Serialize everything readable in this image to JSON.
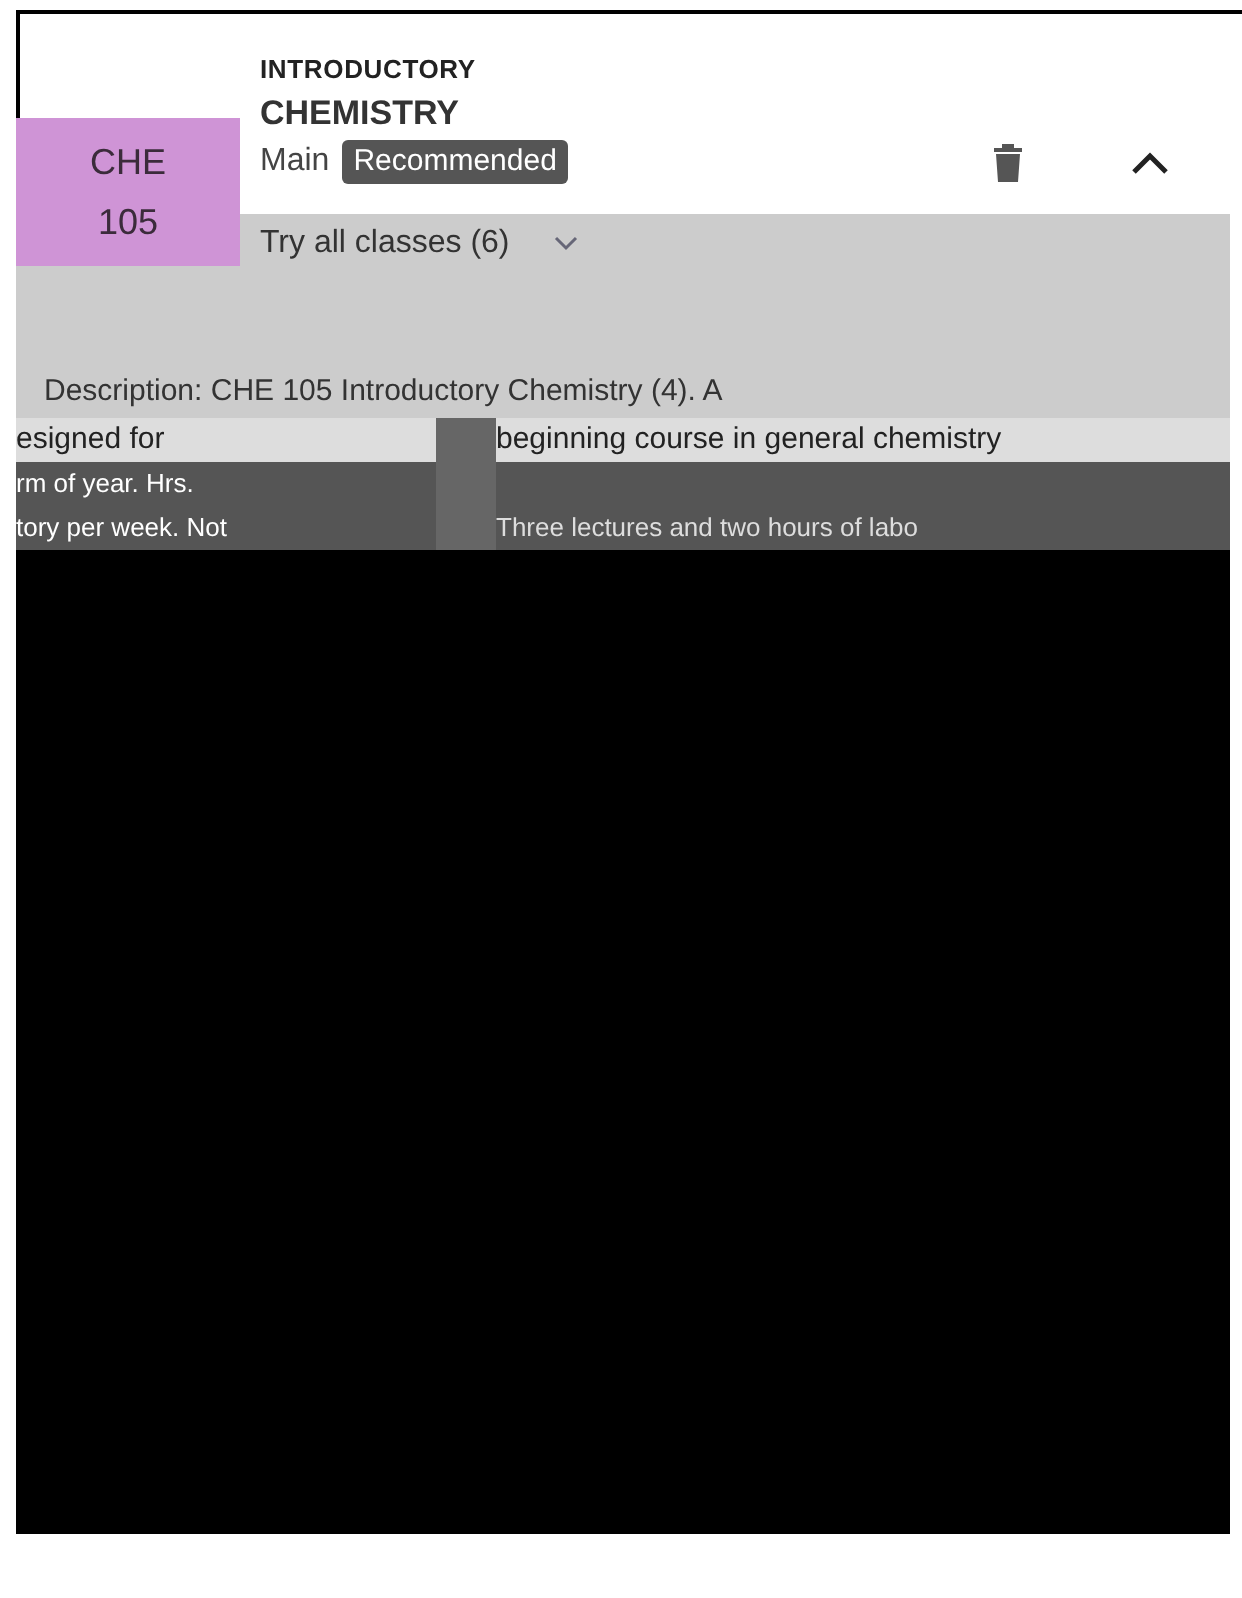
{
  "course": {
    "code": "CHE",
    "number": "105",
    "title_lines": [
      "INTRODUCTORY",
      "CHEMISTRY"
    ],
    "section": "Main",
    "badge": "Recommended",
    "try_all": "Try all classes (6)",
    "expanded": true
  },
  "description": {
    "heading": "Description: CHE 105 Introductory Chemistry (4). A",
    "left_lines": [
      "esigned for",
      "rm of year. Hrs.",
      "tory per week. Not"
    ],
    "right_lines": [
      "beginning course in general chemistry",
      "Three lectures and two hours of labo"
    ]
  }
}
